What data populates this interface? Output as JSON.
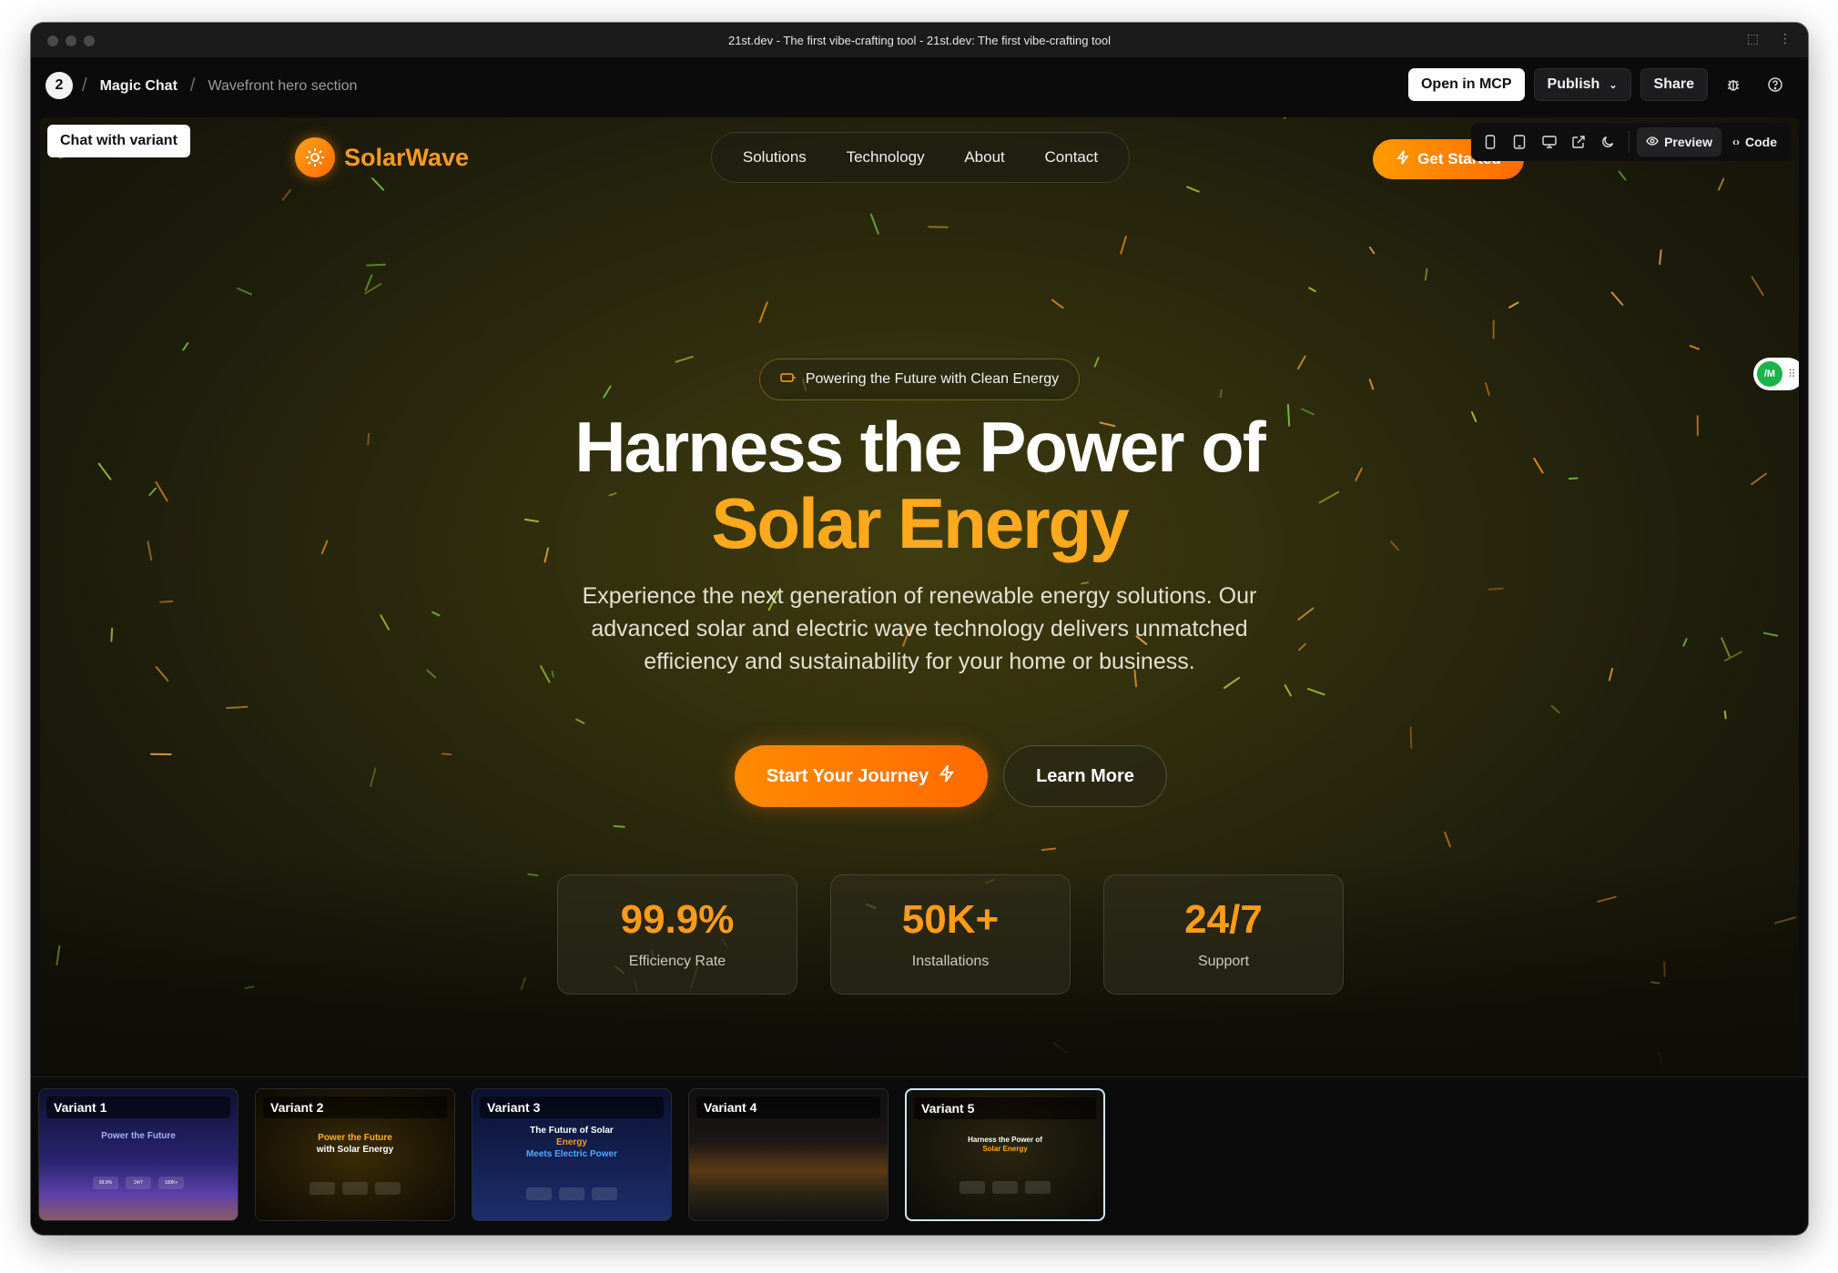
{
  "window": {
    "title": "21st.dev - The first vibe-crafting tool - 21st.dev: The first vibe-crafting tool"
  },
  "appbar": {
    "breadcrumbs": [
      "Magic Chat",
      "Wavefront hero section"
    ],
    "open_in_mcp": "Open in MCP",
    "publish": "Publish",
    "share": "Share"
  },
  "preview_toolbar": {
    "preview_label": "Preview",
    "code_label": "Code",
    "icons": [
      "mobile-icon",
      "tablet-icon",
      "desktop-icon",
      "external-link-icon",
      "moon-icon"
    ]
  },
  "chat_with_variant": "Chat with variant",
  "site": {
    "brand": "SolarWave",
    "nav": [
      "Solutions",
      "Technology",
      "About",
      "Contact"
    ],
    "get_started": "Get Started",
    "badge": "Powering the Future with Clean Energy",
    "headline_line1": "Harness the Power of",
    "headline_line2": "Solar Energy",
    "subtext": "Experience the next generation of renewable energy solutions. Our advanced solar and electric wave technology delivers unmatched efficiency and sustainability for your home or business.",
    "cta_primary": "Start Your Journey",
    "cta_secondary": "Learn More",
    "stats": [
      {
        "value": "99.9%",
        "label": "Efficiency Rate"
      },
      {
        "value": "50K+",
        "label": "Installations"
      },
      {
        "value": "24/7",
        "label": "Support"
      }
    ]
  },
  "mcp_toggle": "/M",
  "variants": [
    {
      "label": "Variant 1",
      "title": "Power the Future",
      "stats": [
        "99.9%",
        "24/7",
        "100K+"
      ]
    },
    {
      "label": "Variant 2",
      "title_a": "Power the Future",
      "title_b": "with Solar Energy"
    },
    {
      "label": "Variant 3",
      "title_a": "The Future of Solar",
      "title_b": "Energy",
      "title_c": "Meets Electric Power"
    },
    {
      "label": "Variant 4"
    },
    {
      "label": "Variant 5",
      "title_a": "Harness the Power of",
      "title_b": "Solar Energy"
    }
  ],
  "colors": {
    "accent_orange": "#ff8a00",
    "brand_orange": "#ff9a1f",
    "headline_gold": "#ffa91e",
    "canvas_olive": "#3f3c10",
    "selected_variant_border": "#cfe6ff"
  }
}
